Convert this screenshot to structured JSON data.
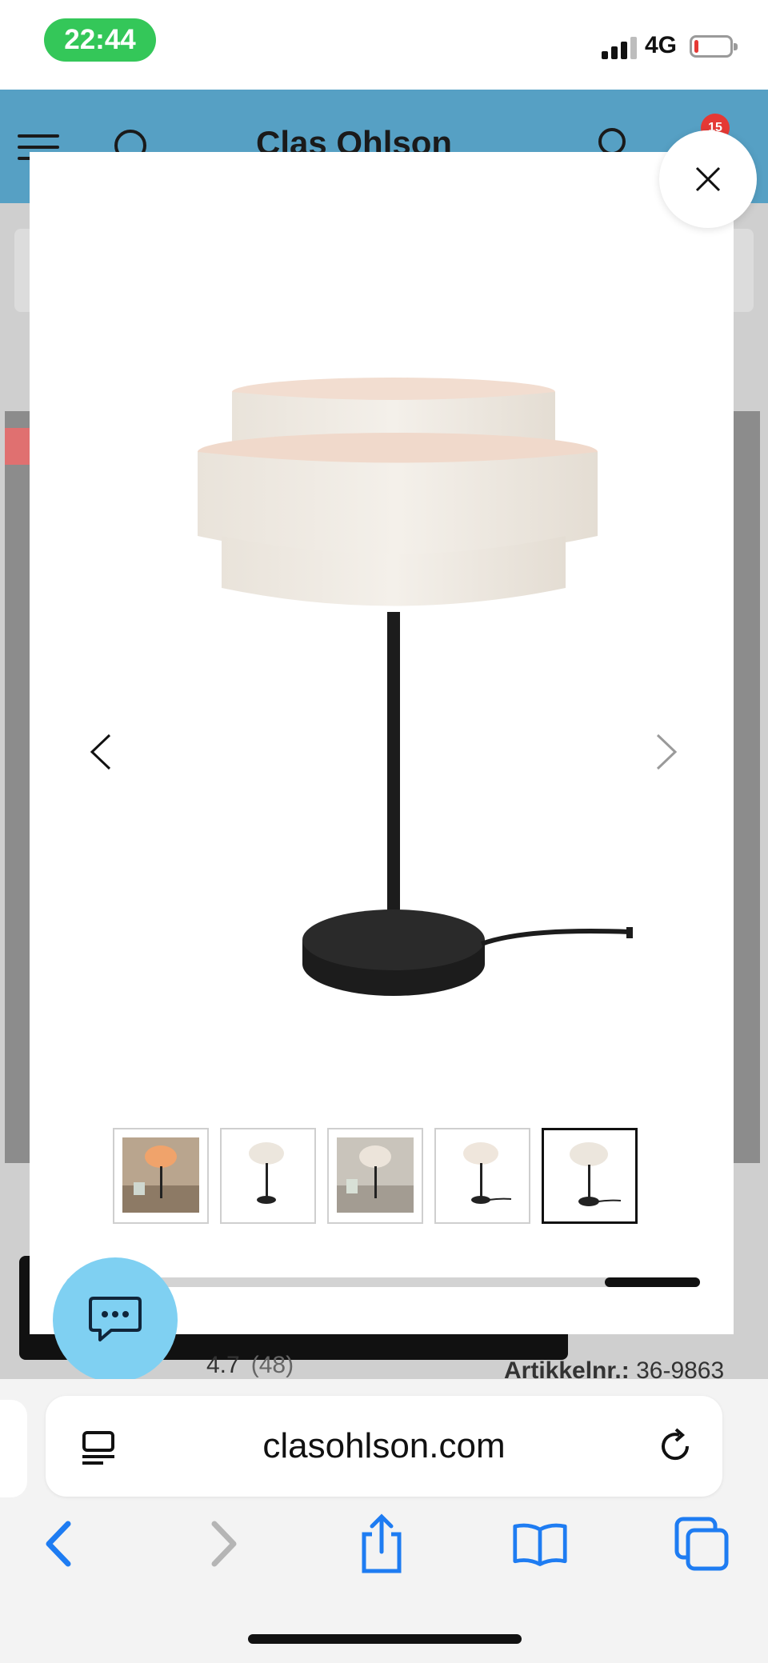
{
  "status_bar": {
    "time": "22:44",
    "network": "4G",
    "battery_level": 0.12
  },
  "site": {
    "logo": "Clas Ohlson",
    "cart_count": "15",
    "rating": "4.7",
    "rating_count": "(48)",
    "sku_label": "Artikkelnr.:",
    "sku_value": "36-9863"
  },
  "gallery": {
    "thumbnail_count": 5,
    "active_thumbnail": 5,
    "scroll_progress": 0.15,
    "icons": {
      "prev": "chevron-left-icon",
      "next": "chevron-right-icon",
      "close": "close-icon",
      "chat": "chat-bubble-icon"
    }
  },
  "browser": {
    "url": "clasohlson.com",
    "accent": "#1e7cf2",
    "toolbar_icons": [
      "back-icon",
      "forward-icon",
      "share-icon",
      "bookmarks-icon",
      "tabs-icon"
    ]
  },
  "colors": {
    "header": "#56a0c4",
    "chat": "#7fd0f2",
    "status_pill": "#34c759"
  }
}
